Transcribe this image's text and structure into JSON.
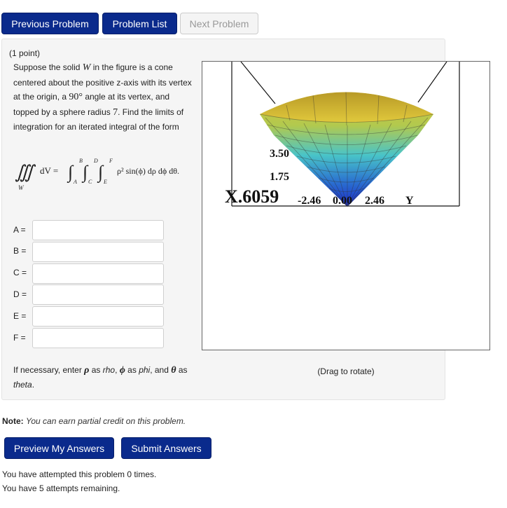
{
  "nav": {
    "previous_label": "Previous Problem",
    "list_label": "Problem List",
    "next_label": "Next Problem"
  },
  "problem": {
    "points": "(1 point)",
    "statement_parts": {
      "p1": "Suppose the solid ",
      "W": "W",
      "p2": " in the figure is a cone centered about the positive z-axis with its vertex at the origin, a ",
      "angle": "90°",
      "p3": " angle at its vertex, and topped by a sphere radius ",
      "radius": "7",
      "p4": ". Find the limits of integration for an iterated integral of the form"
    },
    "formula": {
      "integrand_left": "dV =",
      "region": "W",
      "integrand_right": "ρ² sin(ϕ) dρ dϕ dθ.",
      "limits": {
        "A": "A",
        "B": "B",
        "C": "C",
        "D": "D",
        "E": "E",
        "F": "F"
      }
    },
    "answers": [
      {
        "label": "A =",
        "value": "",
        "placeholder": ""
      },
      {
        "label": "B =",
        "value": "",
        "placeholder": ""
      },
      {
        "label": "C =",
        "value": "",
        "placeholder": ""
      },
      {
        "label": "D =",
        "value": "",
        "placeholder": ""
      },
      {
        "label": "E =",
        "value": "",
        "placeholder": ""
      },
      {
        "label": "F =",
        "value": "",
        "placeholder": ""
      }
    ],
    "hint": {
      "p1": "If necessary, enter ",
      "rho_sym": "ρ",
      "p2": " as ",
      "rho": "rho",
      "p3": ", ",
      "phi_sym": "ϕ",
      "p4": " as ",
      "phi": "phi",
      "p5": ", and ",
      "theta_sym": "θ",
      "p6": " as ",
      "theta": "theta",
      "p7": "."
    },
    "figure": {
      "drag_caption": "(Drag to rotate)",
      "axis_labels": {
        "z_350": "3.50",
        "z_175": "1.75",
        "overlap": "X.6059",
        "x_neg": "-2.46",
        "x_mid": "0.00",
        "x_pos": "2.46",
        "y_axis": "Y"
      },
      "colors": {
        "top": "#d8c23a",
        "mid": "#49c4c8",
        "bottom": "#1a25c9"
      }
    }
  },
  "footer": {
    "note_label": "Note:",
    "note_text": "You can earn partial credit on this problem.",
    "preview_label": "Preview My Answers",
    "submit_label": "Submit Answers",
    "attempted": "You have attempted this problem 0 times.",
    "remaining": "You have 5 attempts remaining."
  }
}
